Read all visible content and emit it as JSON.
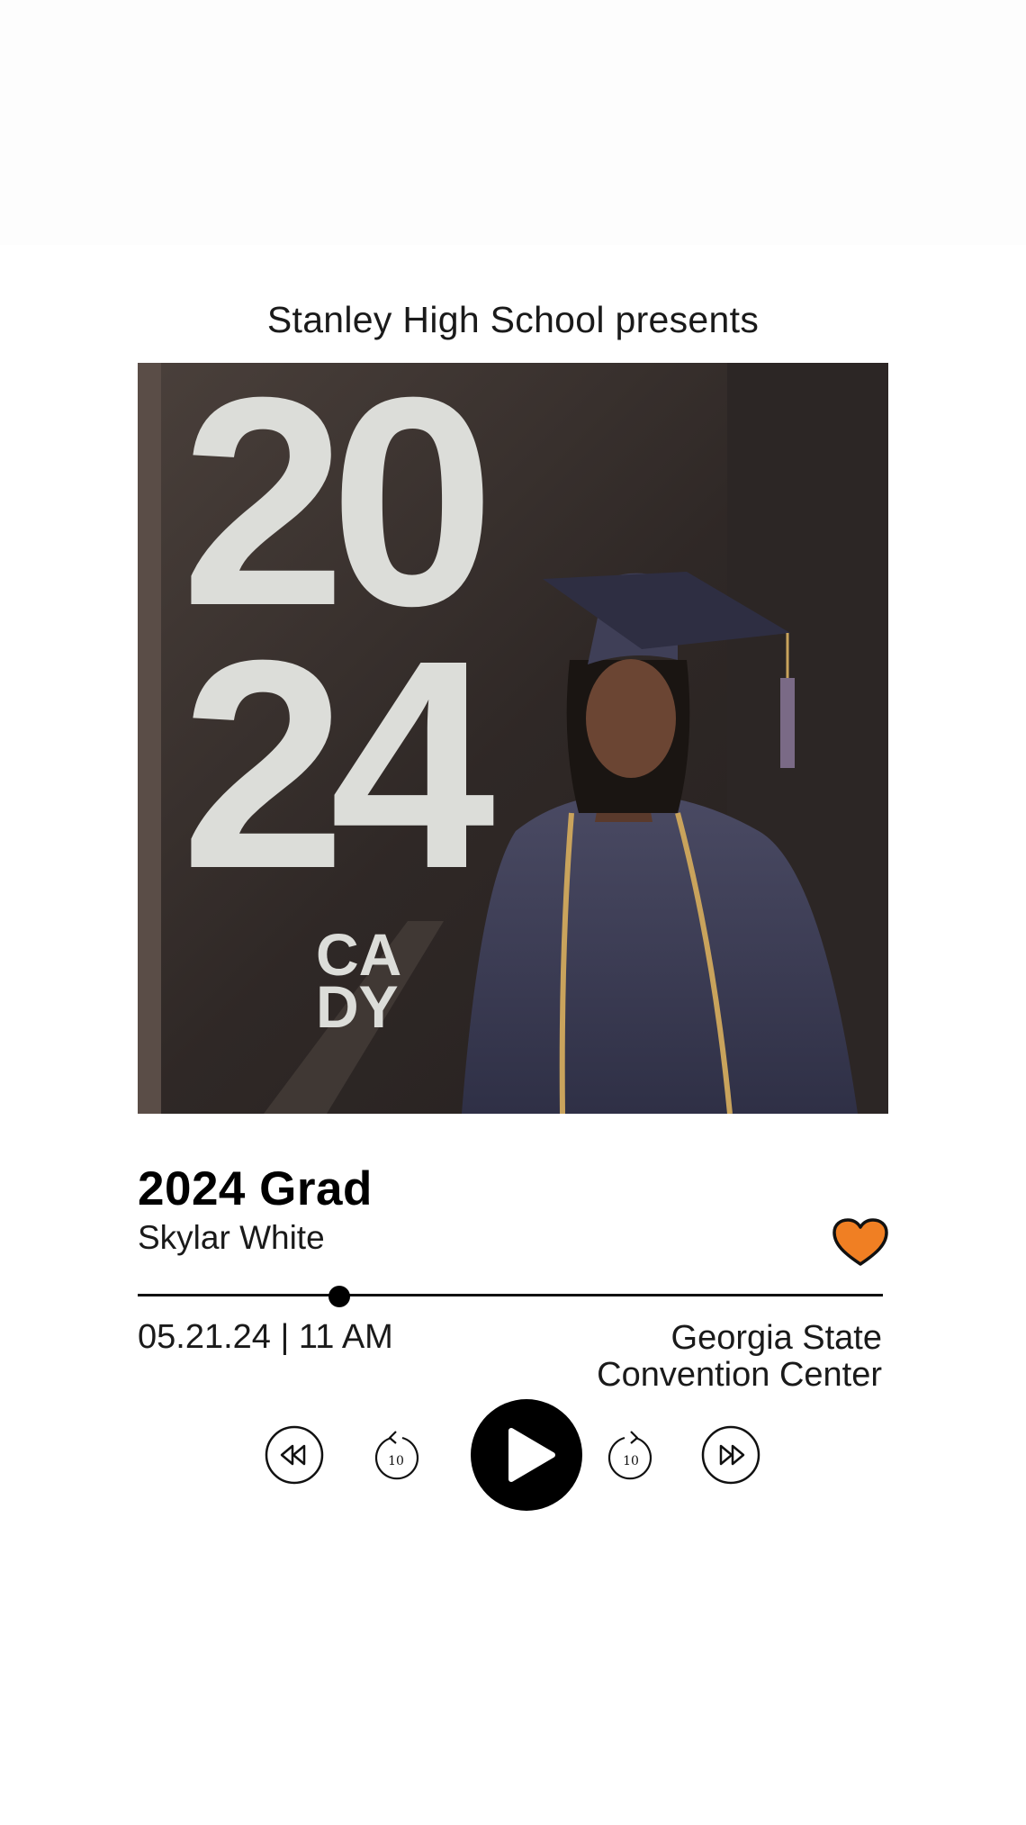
{
  "header": {
    "presenter_text": "Stanley High School presents"
  },
  "photo": {
    "year_top": "20",
    "year_bottom": "24",
    "logo_line1": "CA",
    "logo_line2": "DY"
  },
  "track": {
    "title": "2024 Grad",
    "artist": "Skylar White",
    "liked": true
  },
  "progress": {
    "fraction": 0.27
  },
  "event": {
    "datetime": "05.21.24 | 11 AM",
    "venue_line1": "Georgia State",
    "venue_line2": "Convention Center"
  },
  "controls": {
    "skip_back_seconds": "10",
    "skip_forward_seconds": "10"
  },
  "colors": {
    "heart": "#f07f23",
    "accent": "#000000"
  }
}
